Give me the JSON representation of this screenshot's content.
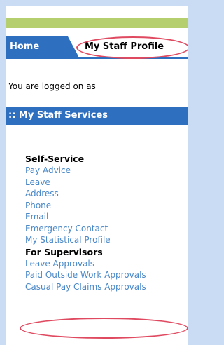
{
  "nav": {
    "home_label": "Home",
    "profile_label": "My Staff Profile"
  },
  "status": {
    "logged_on_text": "You are logged on as"
  },
  "services": {
    "header": ":: My Staff Services",
    "self_service_heading": "Self-Service",
    "self_service_items": [
      "Pay Advice",
      "Leave",
      "Address",
      "Phone",
      "Email",
      "Emergency Contact",
      "My Statistical Profile"
    ],
    "supervisors_heading": "For Supervisors",
    "supervisor_items": [
      "Leave Approvals",
      "Paid Outside Work Approvals",
      "Casual Pay Claims Approvals"
    ]
  },
  "colors": {
    "page_background": "#c9dcf3",
    "accent_blue": "#2e6fbf",
    "accent_green": "#b5cf6e",
    "link_blue": "#4a88c8",
    "highlight_ring": "#e04a60"
  }
}
